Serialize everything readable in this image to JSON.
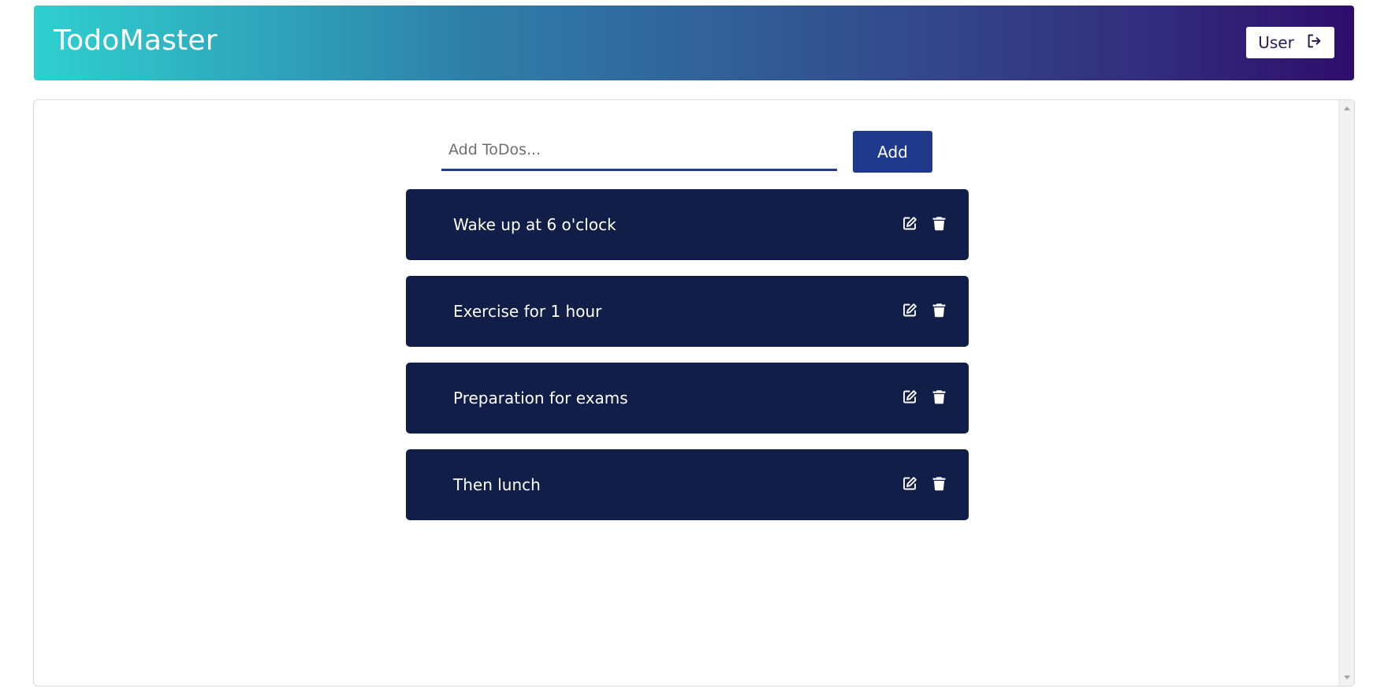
{
  "header": {
    "app_title": "TodoMaster",
    "user_label": "User",
    "logout_icon": "logout-icon"
  },
  "composer": {
    "input_placeholder": "Add ToDos...",
    "input_value": "",
    "add_label": "Add"
  },
  "todos": [
    {
      "text": "Wake up at 6 o'clock"
    },
    {
      "text": "Exercise for 1 hour"
    },
    {
      "text": "Preparation for exams"
    },
    {
      "text": "Then lunch"
    }
  ],
  "icons": {
    "edit": "edit-icon",
    "delete": "trash-icon"
  },
  "colors": {
    "header_gradient_start": "#2fd0cf",
    "header_gradient_end": "#2d0e6c",
    "todo_background": "#111f48",
    "accent": "#1f3a8a"
  }
}
